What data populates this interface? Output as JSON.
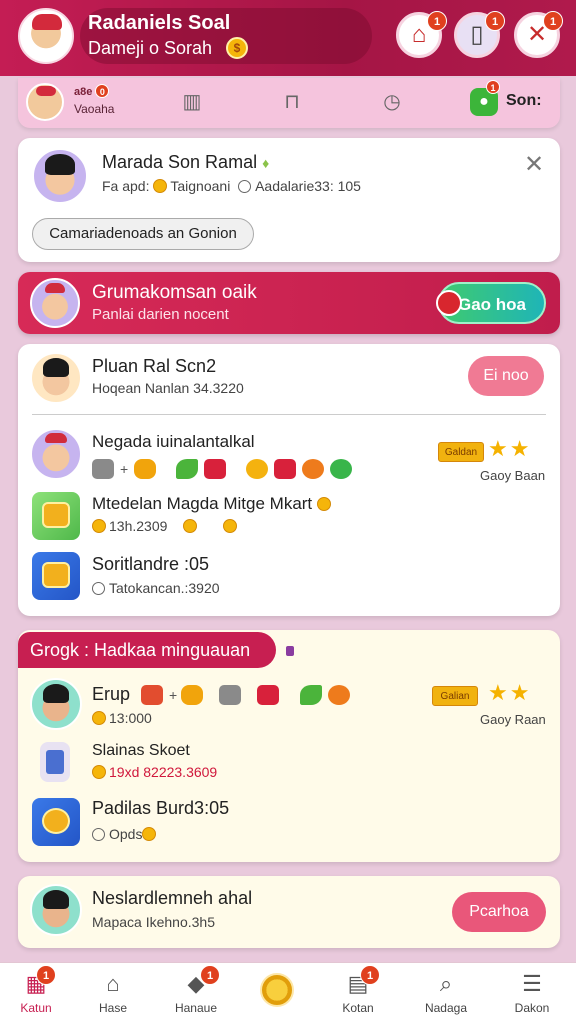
{
  "header": {
    "title": "Radaniels Soal",
    "subtitle": "Dameji o Sorah",
    "coin_glyph": "$",
    "buttons": [
      {
        "icon": "house-icon",
        "badge": "1"
      },
      {
        "icon": "phone-icon",
        "badge": "1"
      },
      {
        "icon": "tools-icon",
        "badge": "1"
      }
    ]
  },
  "status_bar": {
    "name": "a8e",
    "badge": "0",
    "coins": "Vaoaha",
    "right_label": "Son:",
    "right_badge": "1"
  },
  "profile_card": {
    "name": "Marada Son Ramal",
    "meta_left": "Fa apd:",
    "meta_mid": "Taignoani",
    "meta_right": "Aadalarie33: 105",
    "button": "Camariadenoads an Gonion"
  },
  "promo": {
    "title": "Grumakomsan oaik",
    "subtitle": "Panlai darien nocent",
    "button": "Gao hoa"
  },
  "list_card": {
    "item1_name": "Pluan Ral Scn2",
    "item1_meta": "Hoqean Nanlan 34.3220",
    "item1_button": "Ei noo",
    "row_title": "Negada iuinalantalkal",
    "row_tag": "Galdan",
    "row_tag_sub": "Gaoy Baan",
    "row2_title": "Mtedelan Magda Mitge Mkart",
    "row2_meta": "13h.2309",
    "row3_title": "Soritlandre :05",
    "row3_meta": "Tatokancan.:3920"
  },
  "section": {
    "tab_label": "Grogk : Hadkaa minguauan",
    "row_title": "Erup",
    "row_meta": "13:000",
    "row_tag": "Galian",
    "row_tag_sub": "Gaoy Raan",
    "row2_title": "Slainas Skoet",
    "row2_meta": "19xd 82223.3609",
    "row3_title": "Padilas Burd3:05",
    "row3_meta": "Opds"
  },
  "bottom_card": {
    "name": "Neslardlemneh ahal",
    "meta": "Mapaca Ikehno.3h5",
    "button": "Pcarhoa"
  },
  "nav": [
    {
      "label": "Katun",
      "icon": "shop-icon",
      "badge": "1"
    },
    {
      "label": "Hase",
      "icon": "home-icon",
      "badge": ""
    },
    {
      "label": "Hanaue",
      "icon": "shield-icon",
      "badge": "1"
    },
    {
      "label": "",
      "icon": "coin-icon",
      "badge": ""
    },
    {
      "label": "Kotan",
      "icon": "building-icon",
      "badge": "1"
    },
    {
      "label": "Nadaga",
      "icon": "search-icon",
      "badge": ""
    },
    {
      "label": "Dakon",
      "icon": "menu-icon",
      "badge": ""
    }
  ]
}
